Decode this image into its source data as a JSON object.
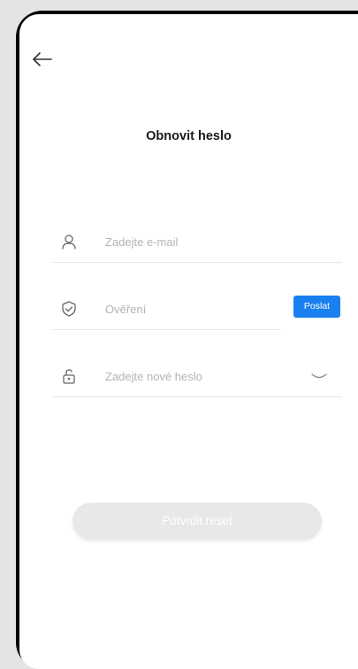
{
  "header": {
    "title": "Obnovit heslo",
    "back_icon": "arrow-left-icon"
  },
  "form": {
    "email": {
      "placeholder": "Zadejte e-mail",
      "icon": "user-icon"
    },
    "verification": {
      "placeholder": "Ověření",
      "icon": "shield-check-icon",
      "send_label": "Poslat"
    },
    "new_password": {
      "placeholder": "Zadejte nové heslo",
      "icon": "unlock-icon",
      "toggle_icon": "eye-closed-icon"
    },
    "confirm_label": "Potvrdit reset"
  },
  "colors": {
    "accent": "#1a80f0",
    "disabled_button": "#e8e8e8",
    "placeholder": "#b3b3b3"
  }
}
